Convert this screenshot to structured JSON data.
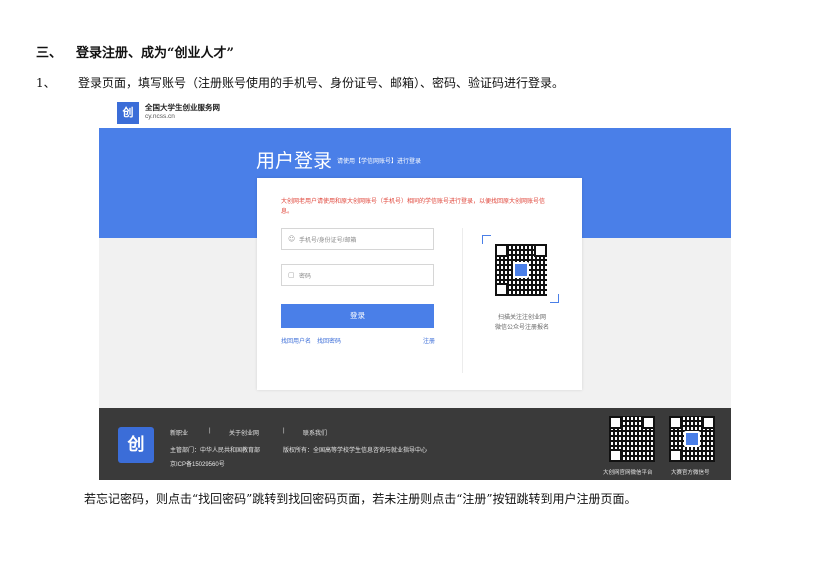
{
  "heading": {
    "number": "三、",
    "text": "登录注册、成为“创业人才”"
  },
  "step": {
    "number": "1、",
    "text": "登录页面，填写账号（注册账号使用的手机号、身份证号、邮箱）、密码、验证码进行登录。"
  },
  "screenshot": {
    "site_name": "全国大学生创业服务网",
    "site_url": "cy.ncss.cn",
    "logo_glyph": "创",
    "login_title": "用户登录",
    "login_subtitle": "请使用【学信网账号】进行登录",
    "notice": "大创网老用户请使用和原大创网账号（手机号）相同的学信账号进行登录，以便找回原大创网账号信息。",
    "account_placeholder": "手机号/身份证号/邮箱",
    "password_placeholder": "密码",
    "login_button": "登录",
    "find_username": "找回用户名",
    "find_password": "找回密码",
    "register": "注册",
    "scan_line1": "扫描关注注创业网",
    "scan_line2": "微信公众号注册报名",
    "footer": {
      "nav": [
        "新职业",
        "|",
        "关于创业网",
        "|",
        "联系我们"
      ],
      "sponsor": "主管部门：中华人民共和国教育部",
      "copyright": "版权所有：全国高等学校学生信息咨询与就业指导中心",
      "icp": "京ICP备15029560号",
      "qr1_caption": "大创网官网微信平台",
      "qr2_caption": "大赛官方微信号"
    },
    "colors": {
      "primary": "#4a7fe8",
      "notice": "#e0453a",
      "footer": "#3a3a3a"
    }
  },
  "note": "若忘记密码，则点击“找回密码”跳转到找回密码页面，若未注册则点击“注册”按钮跳转到用户注册页面。"
}
